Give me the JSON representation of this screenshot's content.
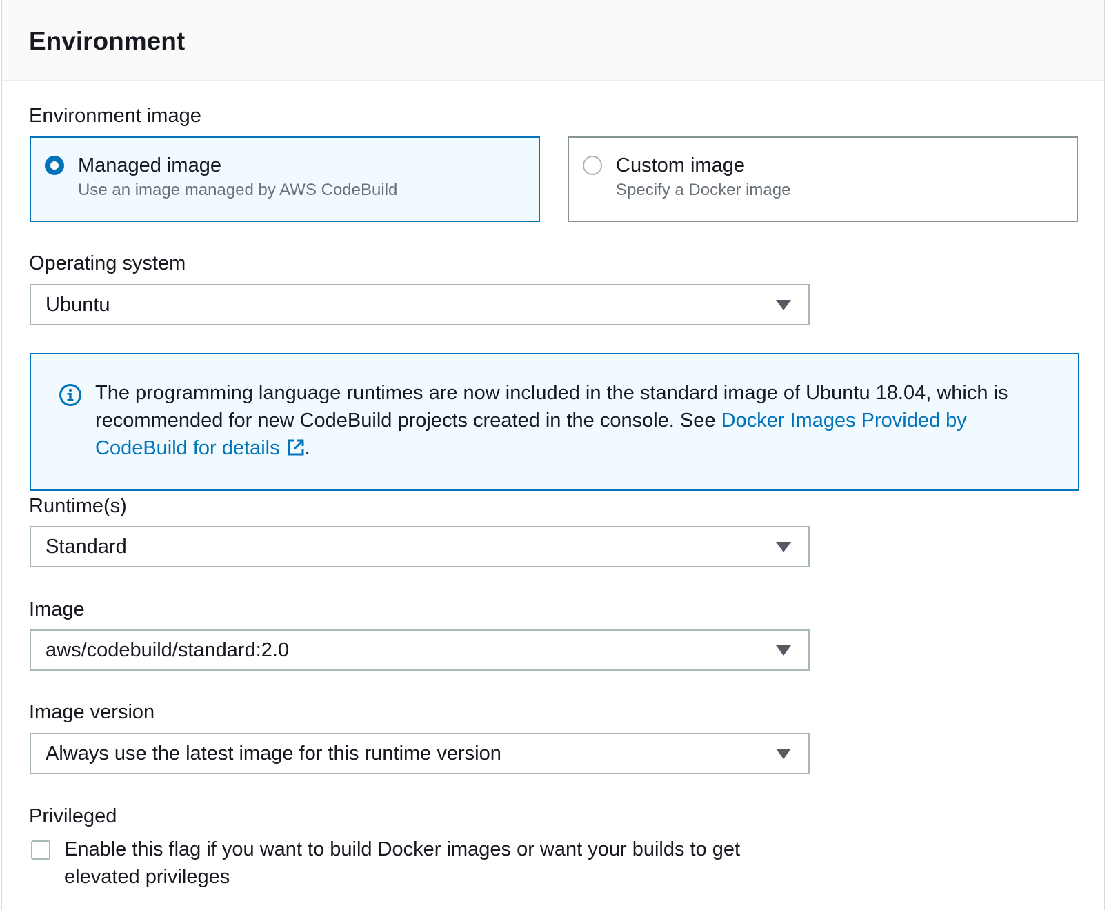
{
  "section": {
    "title": "Environment"
  },
  "environment_image": {
    "label": "Environment image",
    "options": [
      {
        "title": "Managed image",
        "description": "Use an image managed by AWS CodeBuild",
        "selected": true
      },
      {
        "title": "Custom image",
        "description": "Specify a Docker image",
        "selected": false
      }
    ]
  },
  "operating_system": {
    "label": "Operating system",
    "value": "Ubuntu"
  },
  "info": {
    "icon": "info-icon",
    "text": "The programming language runtimes are now included in the standard image of Ubuntu 18.04, which is recommended for new CodeBuild projects created in the console. See ",
    "link_text": "Docker Images Provided by CodeBuild for details",
    "link_icon": "external-link-icon",
    "suffix": "."
  },
  "runtime": {
    "label": "Runtime(s)",
    "value": "Standard"
  },
  "image": {
    "label": "Image",
    "value": "aws/codebuild/standard:2.0"
  },
  "image_version": {
    "label": "Image version",
    "value": "Always use the latest image for this runtime version"
  },
  "privileged": {
    "label": "Privileged",
    "checkbox_label": "Enable this flag if you want to build Docker images or want your builds to get elevated privileges",
    "checked": false
  },
  "colors": {
    "accent": "#0073bb",
    "info_background": "#f1faff",
    "border": "#aab7b8",
    "muted_text": "#687078"
  }
}
